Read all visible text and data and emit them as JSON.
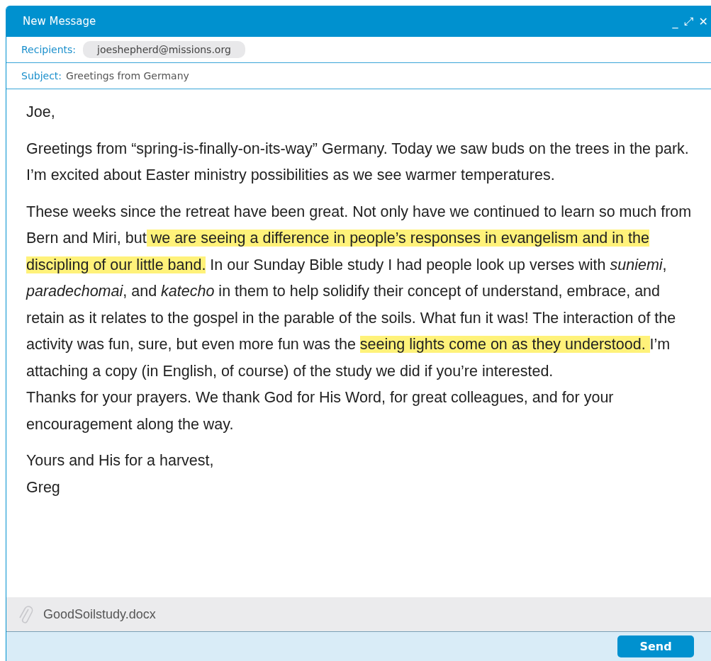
{
  "window": {
    "title": "New Message",
    "controls": [
      "_",
      "⤢",
      "✕"
    ]
  },
  "recipients": {
    "label": "Recipients:",
    "chips": [
      "joeshepherd@missions.org"
    ]
  },
  "subject": {
    "label": "Subject:",
    "value": "Greetings from Germany"
  },
  "body": [
    {
      "lines": [
        [
          {
            "text": "Joe,",
            "highlighted": false
          }
        ]
      ]
    },
    {
      "lines": [
        [
          {
            "text": "Greetings from “spring-is-finally-on-its-way” Germany. Today we saw buds on the trees in the park. I’m excited about Easter ministry possibilities as we see warmer temperatures.",
            "highlighted": false
          }
        ]
      ]
    },
    {
      "lines": [
        [
          {
            "text": "These weeks since the retreat have been great. Not only have we continued to learn so much from Bern and Miri, but",
            "highlighted": false
          },
          {
            "text": " we are seeing a difference in people’s responses in evangelism and in the discipling of our little band.",
            "highlighted": true
          },
          {
            "text": " In our Sunday Bible study I had people look up verses with *suniemi*, *paradechomai*, and *katecho* in them to help solidify their concept of understand, embrace, and retain as it relates to the gospel in the parable of the soils. What fun it was! The interaction of the activity was fun, sure, but even more fun was the ",
            "highlighted": false
          },
          {
            "text": "seeing lights come on as they understood. ",
            "highlighted": true
          },
          {
            "text": "I’m attaching a copy (in English, of course) of the study we did if you’re interested.",
            "highlighted": false
          }
        ],
        [
          {
            "text": "Thanks for your prayers. We thank God for His Word, for great colleagues, and for your encouragement along the way.",
            "highlighted": false
          }
        ]
      ]
    },
    {
      "lines": [
        [
          {
            "text": "Yours and His for a harvest,",
            "highlighted": false
          }
        ],
        [
          {
            "text": "Greg",
            "highlighted": false
          }
        ]
      ]
    }
  ],
  "attachments": [
    "GoodSoilstudy.docx"
  ],
  "send_button": "Send"
}
